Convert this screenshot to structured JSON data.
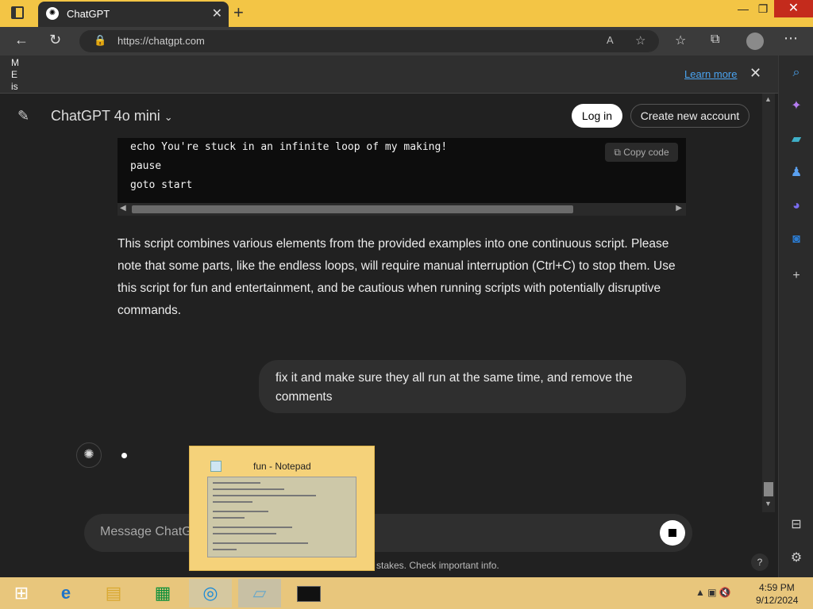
{
  "browser": {
    "tab_title": "ChatGPT",
    "url": "https://chatgpt.com",
    "infobar_letters": [
      "M",
      "E",
      "is"
    ],
    "learn_more": "Learn more"
  },
  "header": {
    "model_name": "ChatGPT 4o mini",
    "login_label": "Log in",
    "signup_label": "Create new account"
  },
  "code": {
    "lines": [
      "echo You're stuck in an infinite loop of my making!",
      "pause",
      "goto start"
    ],
    "copy_label": "Copy code"
  },
  "assistant_message": "This script combines various elements from the provided examples into one continuous script. Please note that some parts, like the endless loops, will require manual interruption (Ctrl+C) to stop them. Use this script for fun and entertainment, and be cautious when running scripts with potentially disruptive commands.",
  "user_message": "fix it and make sure they all run at the same time, and remove the comments",
  "composer": {
    "placeholder": "Message ChatG",
    "disclaimer": "stakes. Check important info."
  },
  "help_label": "?",
  "thumbnail": {
    "title": "fun - Notepad"
  },
  "taskbar": {
    "time": "4:59 PM",
    "date": "9/12/2024"
  },
  "colors": {
    "accent_taskbar": "#e8c67c",
    "titlebar": "#f3c545",
    "page_bg": "#212121"
  }
}
